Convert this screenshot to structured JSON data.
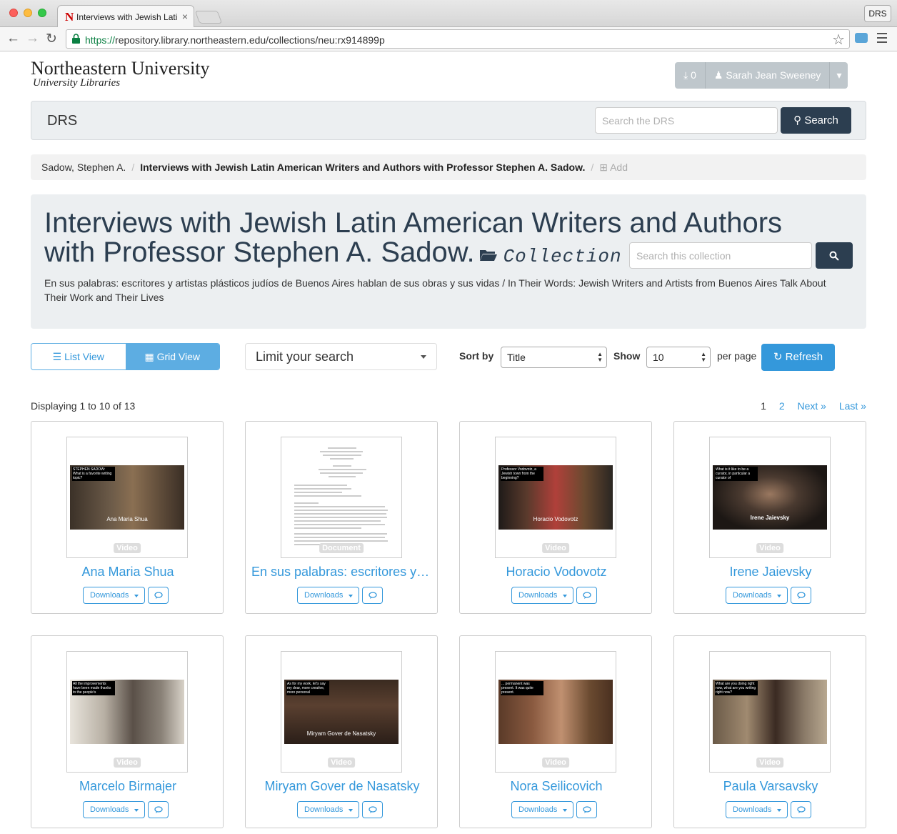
{
  "browser": {
    "tab_title": "Interviews with Jewish Lati",
    "tab_close": "×",
    "favicon_letter": "N",
    "profile": "DRS",
    "url_secure": "https://",
    "url_host_path": "repository.library.northeastern.edu/collections/neu:rx914899p"
  },
  "header": {
    "logo_main": "Northeastern University",
    "logo_sub": "University Libraries",
    "download_count": "0",
    "user_name": "Sarah Jean Sweeney"
  },
  "drs_bar": {
    "title": "DRS",
    "search_placeholder": "Search the DRS",
    "search_label": "Search"
  },
  "breadcrumb": {
    "parent": "Sadow, Stephen A.",
    "current": "Interviews with Jewish Latin American Writers and Authors with Professor Stephen A. Sadow.",
    "add": "Add"
  },
  "collection": {
    "title": "Interviews with Jewish Latin American Writers and Authors with Professor Stephen A. Sadow.",
    "type_label": "Collection",
    "search_placeholder": "Search this collection",
    "description": "En sus palabras: escritores y artistas plásticos judíos de Buenos Aires hablan de sus obras y sus vidas / In Their Words: Jewish Writers and Artists from Buenos Aires Talk About Their Work and Their Lives"
  },
  "toolbar": {
    "list_view": "List View",
    "grid_view": "Grid View",
    "limit_search": "Limit your search",
    "sort_by_label": "Sort by",
    "sort_value": "Title",
    "show_label": "Show",
    "show_value": "10",
    "per_page_label": "per page",
    "refresh_label": "Refresh"
  },
  "results": {
    "display_text": "Displaying 1 to 10 of 13",
    "pages": [
      "1",
      "2",
      "Next »",
      "Last »"
    ]
  },
  "items": [
    {
      "title": "Ana Maria Shua",
      "type": "Video",
      "caption": "STEPHEN SADOW: What is a favorite writing topic?",
      "name_overlay": "Ana Maria Shua",
      "downloads": "Downloads"
    },
    {
      "title": "En sus palabras: escritores y …",
      "type": "Document",
      "caption": "",
      "name_overlay": "",
      "downloads": "Downloads"
    },
    {
      "title": "Horacio Vodovotz",
      "type": "Video",
      "caption": "Professor Vodovotz, a Jewish town from the beginning?",
      "name_overlay": "Horacio Vodovotz",
      "downloads": "Downloads"
    },
    {
      "title": "Irene Jaievsky",
      "type": "Video",
      "caption": "What is it like to be a curator, in particular a curator of",
      "name_overlay": "Irene Jaievsky",
      "downloads": "Downloads"
    },
    {
      "title": "Marcelo Birmajer",
      "type": "Video",
      "caption": "All the improvements have been made thanks to the people's",
      "name_overlay": "",
      "downloads": "Downloads"
    },
    {
      "title": "Miryam Gover de Nasatsky",
      "type": "Video",
      "caption": "As for my work, let's say my dear, more creative, more personal",
      "name_overlay": "Miryam Gover de Nasatsky",
      "downloads": "Downloads"
    },
    {
      "title": "Nora Seilicovich",
      "type": "Video",
      "caption": "... permanent was present. It was quite present.",
      "name_overlay": "",
      "downloads": "Downloads"
    },
    {
      "title": "Paula Varsavsky",
      "type": "Video",
      "caption": "What are you doing right now, what are you writing right now?",
      "name_overlay": "",
      "downloads": "Downloads"
    }
  ],
  "colors": {
    "brand_navy": "#2c3e50",
    "link_blue": "#3498db",
    "panel_gray": "#eceff1",
    "user_button": "#bfc7cc"
  }
}
